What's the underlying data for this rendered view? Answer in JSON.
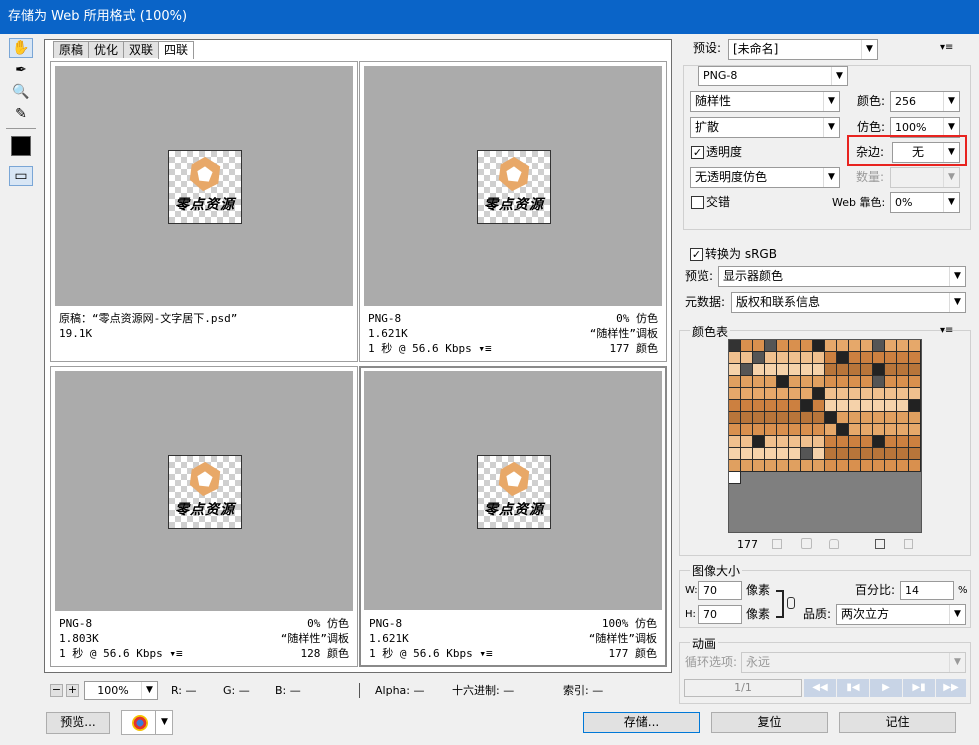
{
  "window": {
    "title": "存储为 Web 所用格式 (100%)"
  },
  "tabs": [
    "原稿",
    "优化",
    "双联",
    "四联"
  ],
  "panes": [
    {
      "line1_left": "原稿：“零点资源网-文字居下.psd”",
      "line1_right": "",
      "line2_left": "19.1K",
      "line2_right": "",
      "line3_left": "",
      "line3_right": ""
    },
    {
      "line1_left": "PNG-8",
      "line1_right": "0% 仿色",
      "line2_left": "1.621K",
      "line2_right": "“随样性”调板",
      "line3_left": "1 秒 @ 56.6 Kbps",
      "line3_right": "177 颜色"
    },
    {
      "line1_left": "PNG-8",
      "line1_right": "0% 仿色",
      "line2_left": "1.803K",
      "line2_right": "“随样性”调板",
      "line3_left": "1 秒 @ 56.6 Kbps",
      "line3_right": "128 颜色"
    },
    {
      "line1_left": "PNG-8",
      "line1_right": "100% 仿色",
      "line2_left": "1.621K",
      "line2_right": "“随样性”调板",
      "line3_left": "1 秒 @ 56.6 Kbps",
      "line3_right": "177 颜色"
    }
  ],
  "logo_text": "零点资源",
  "statusbar": {
    "zoom": "100%",
    "r": "R: —",
    "g": "G: —",
    "b": "B: —",
    "alpha": "Alpha: —",
    "hex": "十六进制: —",
    "index": "索引: —"
  },
  "bottom_buttons": {
    "preview": "预览...",
    "save": "存储...",
    "reset": "复位",
    "remember": "记住"
  },
  "settings": {
    "preset_label": "预设:",
    "preset_value": "[未命名]",
    "format": "PNG-8",
    "reduction": "随样性",
    "colors_label": "颜色:",
    "colors_value": "256",
    "dither_algo": "扩散",
    "dither_label": "仿色:",
    "dither_value": "100%",
    "transparency_label": "透明度",
    "matte_label": "杂边:",
    "matte_value": "无",
    "transparency_dither": "无透明度仿色",
    "amount_label": "数量:",
    "interlaced_label": "交错",
    "websnap_label": "Web 靠色:",
    "websnap_value": "0%",
    "srgb_label": "转换为 sRGB",
    "preview_label": "预览:",
    "preview_value": "显示器颜色",
    "metadata_label": "元数据:",
    "metadata_value": "版权和联系信息"
  },
  "color_table": {
    "title": "颜色表",
    "count": "177"
  },
  "image_size": {
    "title": "图像大小",
    "w_label": "W:",
    "w_value": "70",
    "h_label": "H:",
    "h_value": "70",
    "unit": "像素",
    "percent_label": "百分比:",
    "percent_value": "14",
    "percent_unit": "%",
    "quality_label": "品质:",
    "quality_value": "两次立方"
  },
  "animation": {
    "title": "动画",
    "loop_label": "循环选项:",
    "loop_value": "永远",
    "frame": "1/1"
  },
  "colors": {
    "accent": "#0a64c8",
    "highlight": "#e8231f",
    "logo": "#e8a868"
  }
}
